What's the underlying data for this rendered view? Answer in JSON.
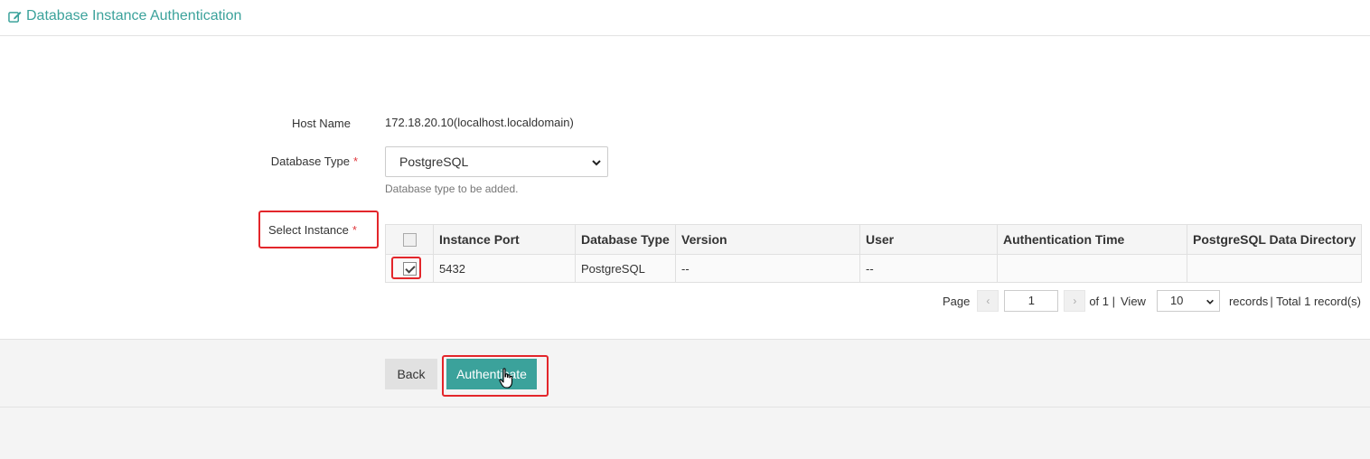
{
  "header": {
    "title": "Database Instance Authentication",
    "icon": "edit-icon"
  },
  "form": {
    "host_name_label": "Host Name",
    "host_name_value": "172.18.20.10(localhost.localdomain)",
    "db_type_label": "Database Type",
    "db_type_required": "*",
    "db_type_value": "PostgreSQL",
    "db_type_help": "Database type to be added.",
    "select_instance_label": "Select Instance",
    "select_instance_required": "*"
  },
  "table": {
    "columns": [
      "Instance Port",
      "Database Type",
      "Version",
      "User",
      "Authentication Time",
      "PostgreSQL Data Directory"
    ],
    "rows": [
      {
        "checked": true,
        "cells": [
          "5432",
          "PostgreSQL",
          "--",
          "--",
          "",
          ""
        ]
      }
    ]
  },
  "pager": {
    "page_label": "Page",
    "prev": "‹",
    "page_value": "1",
    "next": "›",
    "of_text": "of 1 |",
    "view_label": "View",
    "view_value": "10",
    "records_text": "records",
    "total_text": "| Total 1 record(s)"
  },
  "actions": {
    "back_label": "Back",
    "authenticate_label": "Authenticate"
  },
  "colors": {
    "accent": "#3ba29b",
    "highlight": "#e3262b",
    "required": "#e0393e"
  }
}
